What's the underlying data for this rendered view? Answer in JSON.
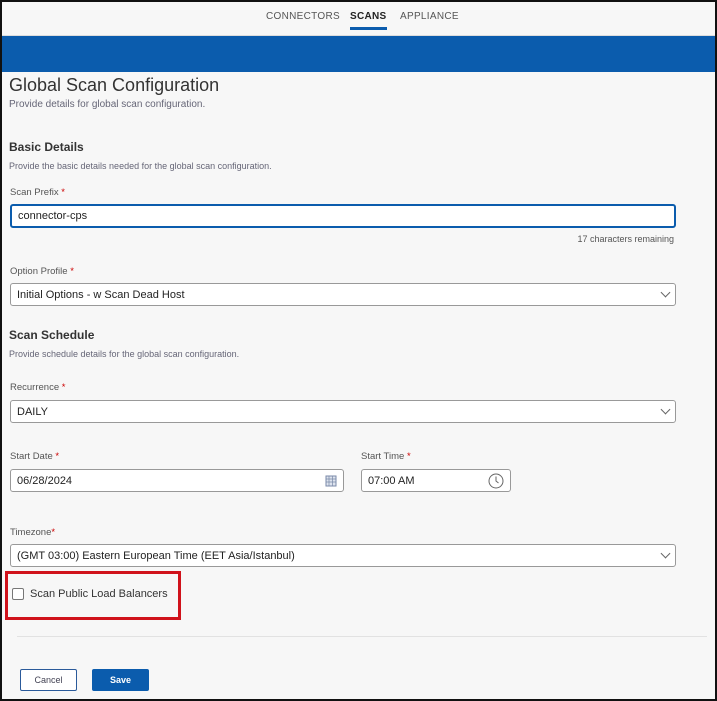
{
  "nav": {
    "tabs": [
      {
        "label": "CONNECTORS"
      },
      {
        "label": "SCANS",
        "active": true
      },
      {
        "label": "APPLIANCE"
      }
    ]
  },
  "page": {
    "title": "Global Scan Configuration",
    "subtitle": "Provide details for global scan configuration."
  },
  "basic": {
    "title": "Basic Details",
    "desc": "Provide the basic details needed for the global scan configuration.",
    "scan_prefix_label": "Scan Prefix",
    "scan_prefix_value": "connector-cps",
    "chars_remaining": "17 characters remaining",
    "option_profile_label": "Option Profile",
    "option_profile_value": "Initial Options - w Scan Dead Host"
  },
  "schedule": {
    "title": "Scan Schedule",
    "desc": "Provide schedule details for the global scan configuration.",
    "recurrence_label": "Recurrence",
    "recurrence_value": "DAILY",
    "start_date_label": "Start Date",
    "start_date_value": "06/28/2024",
    "start_time_label": "Start Time",
    "start_time_value": "07:00 AM",
    "timezone_label": "Timezone",
    "timezone_value": "(GMT 03:00) Eastern European Time (EET Asia/Istanbul)"
  },
  "options": {
    "scan_public_lb_label": "Scan Public Load Balancers",
    "scan_public_lb_checked": false
  },
  "required_marker": "*",
  "actions": {
    "cancel": "Cancel",
    "save": "Save"
  },
  "colors": {
    "brand": "#0b5cad",
    "highlight": "#d0121b"
  }
}
